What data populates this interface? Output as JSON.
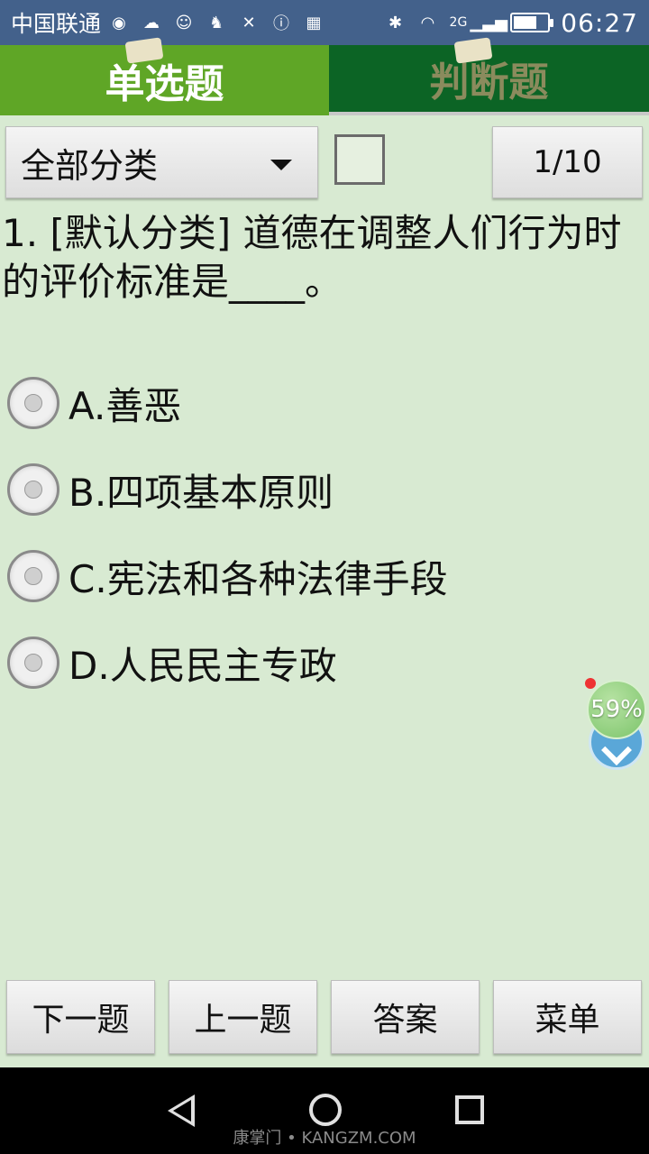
{
  "status_bar": {
    "carrier": "中国联通",
    "network": "2G",
    "time": "06:27",
    "battery_level": 0.7
  },
  "tabs": [
    {
      "label": "单选题",
      "active": true
    },
    {
      "label": "判断题",
      "active": false
    }
  ],
  "filter": {
    "category": "全部分类",
    "counter": "1/10"
  },
  "question": {
    "text": "1. [默认分类] 道德在调整人们行为时的评价标准是____。"
  },
  "options": [
    {
      "label": "A.善恶"
    },
    {
      "label": "B.四项基本原则"
    },
    {
      "label": "C.宪法和各种法律手段"
    },
    {
      "label": "D.人民民主专政"
    }
  ],
  "floating_widget": {
    "percent": "59%"
  },
  "buttons": {
    "next": "下一题",
    "prev": "上一题",
    "answer": "答案",
    "menu": "菜单"
  },
  "watermark": "康掌门 • KANGZM.COM",
  "colors": {
    "status_bar": "#43618b",
    "tab_active": "#5fa626",
    "tab_inactive": "#0c6425",
    "background": "#d8ead2"
  }
}
